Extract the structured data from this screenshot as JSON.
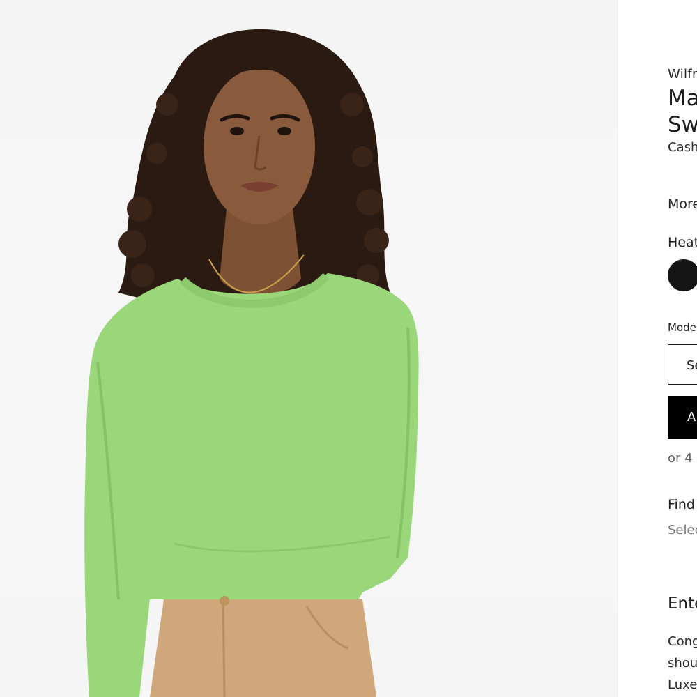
{
  "product": {
    "brand": "Wilfr",
    "title_line1": "Ma",
    "title_line2": "Sw",
    "subtitle": "Cash",
    "more_link": "More",
    "color_label": "Heat",
    "swatch_color": "#151515",
    "model_label": "Mode",
    "size_select_label": "Se",
    "add_button_label": "A",
    "installments_text": "or 4",
    "find_label": "Find",
    "find_sub": "Selec"
  },
  "promo": {
    "heading": "Ente",
    "line1": "Cong",
    "line2": "shou",
    "line3": "Luxe"
  },
  "image": {
    "sweater_color": "#9ad67a",
    "pants_color": "#cfa77a",
    "hair_color": "#2b1a12",
    "skin_color": "#8a5a3c"
  }
}
